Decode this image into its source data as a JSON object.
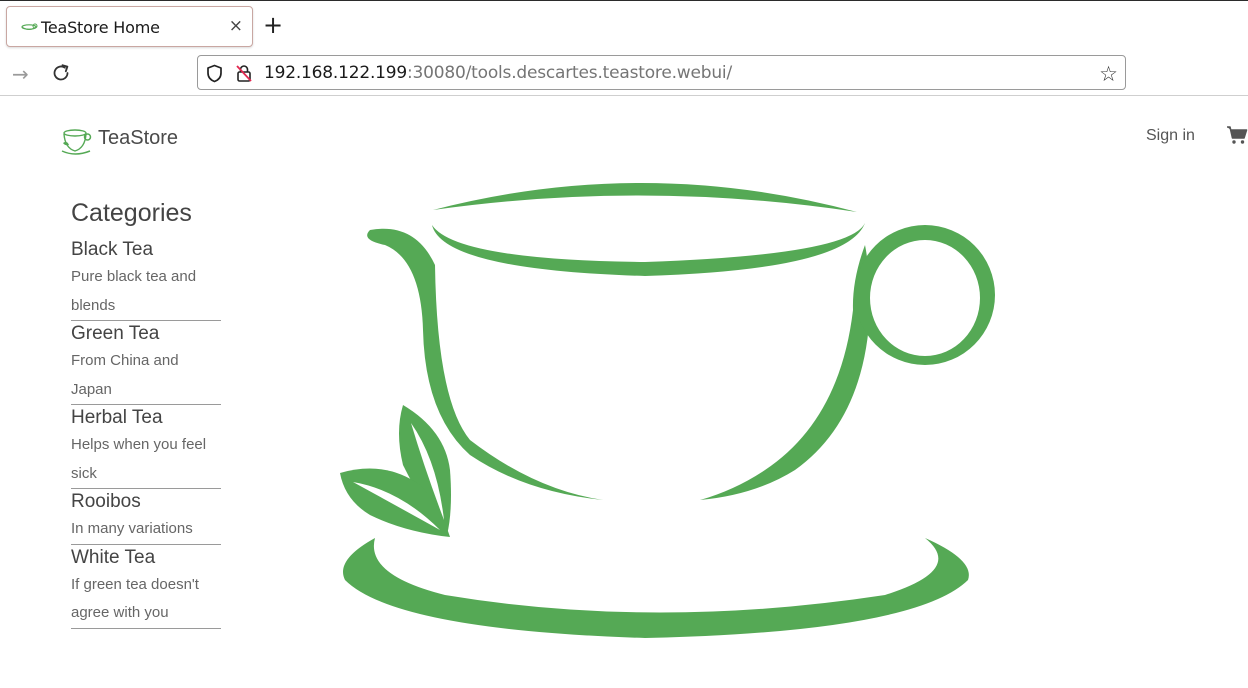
{
  "browser": {
    "tab_title": "TeaStore Home",
    "tab_close": "×",
    "new_tab": "+",
    "url_host": "192.168.122.199",
    "url_rest": ":30080/tools.descartes.teastore.webui/",
    "forward_glyph": "→",
    "star_glyph": "☆"
  },
  "header": {
    "brand": "TeaStore",
    "sign_in": "Sign in",
    "cart_icon": "shopping-cart-icon"
  },
  "sidebar": {
    "heading": "Categories",
    "items": [
      {
        "name": "Black Tea",
        "description": "Pure black tea and blends"
      },
      {
        "name": "Green Tea",
        "description": "From China and Japan"
      },
      {
        "name": "Herbal Tea",
        "description": "Helps when you feel sick"
      },
      {
        "name": "Rooibos",
        "description": "In many variations"
      },
      {
        "name": "White Tea",
        "description": "If green tea doesn't agree with you"
      }
    ]
  },
  "colors": {
    "brand_green": "#55a955",
    "text_dark": "#444444"
  }
}
